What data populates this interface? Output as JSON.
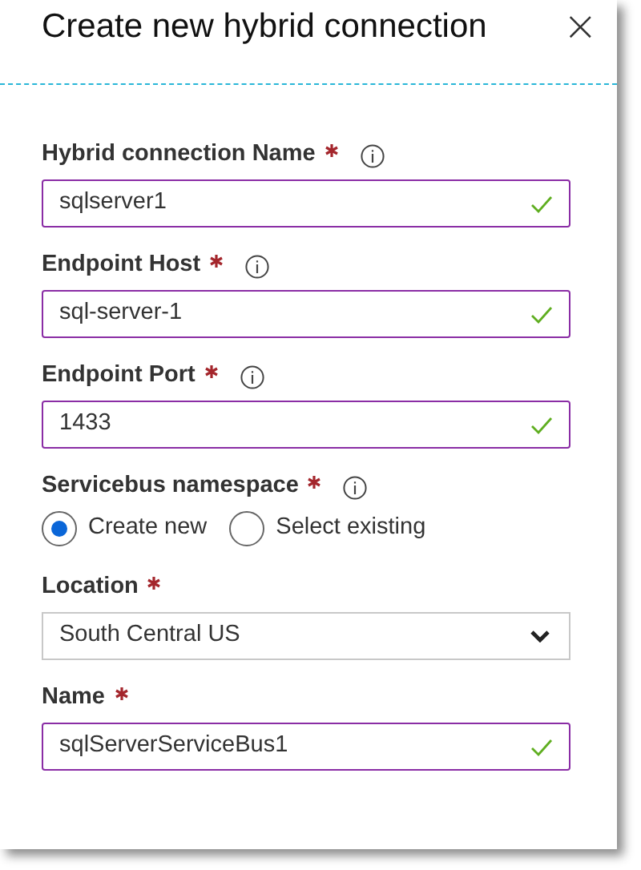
{
  "panel": {
    "title": "Create new hybrid connection",
    "close_icon": "×"
  },
  "fields": [
    {
      "kind": "text",
      "label": "Hybrid connection Name",
      "required": true,
      "info": true,
      "value": "sqlserver1",
      "valid": true
    },
    {
      "kind": "text",
      "label": "Endpoint Host",
      "required": true,
      "info": true,
      "value": "sql-server-1",
      "valid": true
    },
    {
      "kind": "text",
      "label": "Endpoint Port",
      "required": true,
      "info": true,
      "value": "1433",
      "valid": true
    },
    {
      "kind": "radio",
      "label": "Servicebus namespace",
      "required": true,
      "info": true,
      "options": [
        {
          "label": "Create new",
          "selected": true
        },
        {
          "label": "Select existing",
          "selected": false
        }
      ]
    },
    {
      "kind": "select",
      "label": "Location",
      "required": true,
      "info": false,
      "value": "South Central US"
    },
    {
      "kind": "text",
      "label": "Name",
      "required": true,
      "info": false,
      "value": "sqlServerServiceBus1",
      "valid": true
    }
  ]
}
